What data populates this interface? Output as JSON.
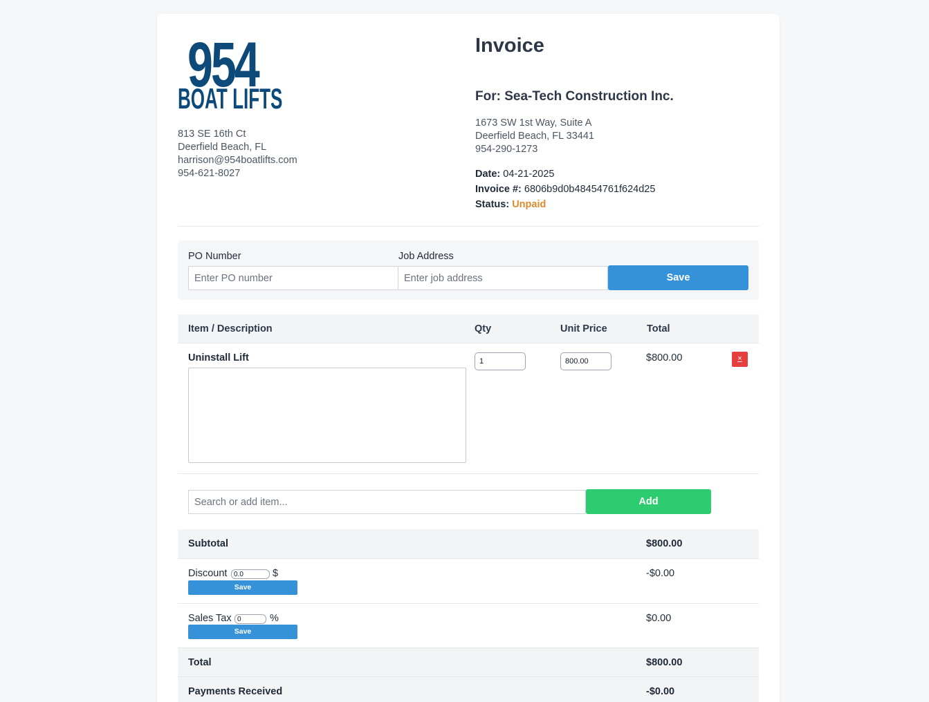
{
  "business": {
    "logo_number": "954",
    "logo_words": "BOAT LIFTS",
    "address_line1": "813 SE 16th Ct",
    "address_line2": "Deerfield Beach, FL",
    "email": "harrison@954boatlifts.com",
    "phone": "954-621-8027"
  },
  "invoice": {
    "title": "Invoice",
    "for_line": "For: Sea-Tech Construction Inc.",
    "client_address_line1": "1673 SW 1st Way, Suite A",
    "client_address_line2": "Deerfield Beach, FL 33441",
    "client_phone": "954-290-1273",
    "date_label": "Date:",
    "date_value": "04-21-2025",
    "number_label": "Invoice #:",
    "number_value": "6806b9d0b48454761f624d25",
    "status_label": "Status:",
    "status_value": "Unpaid",
    "status_color": "#dd8a2e"
  },
  "po_form": {
    "po_label": "PO Number",
    "po_placeholder": "Enter PO number",
    "job_label": "Job Address",
    "job_placeholder": "Enter job address",
    "save_label": "Save"
  },
  "table": {
    "headers": {
      "item": "Item / Description",
      "qty": "Qty",
      "unit_price": "Unit Price",
      "total": "Total"
    },
    "rows": [
      {
        "name": "Uninstall Lift",
        "description": "",
        "qty": "1",
        "unit_price": "800.00",
        "total": "$800.00",
        "delete_glyph": "×"
      }
    ]
  },
  "add_item": {
    "placeholder": "Search or add item...",
    "add_label": "Add"
  },
  "summary": {
    "subtotal_label": "Subtotal",
    "subtotal_value": "$800.00",
    "discount_label": "Discount",
    "discount_input": "0.0",
    "discount_unit": "$",
    "discount_value": "-$0.00",
    "discount_save": "Save",
    "tax_label": "Sales Tax",
    "tax_input": "0",
    "tax_unit": "%",
    "tax_value": "$0.00",
    "tax_save": "Save",
    "total_label": "Total",
    "total_value": "$800.00",
    "payments_label": "Payments Received",
    "payments_value": "-$0.00"
  },
  "colors": {
    "brand_navy": "#0d4a7a",
    "primary_blue": "#3592d8",
    "add_green": "#2ecc71",
    "delete_red": "#e53e3e"
  }
}
